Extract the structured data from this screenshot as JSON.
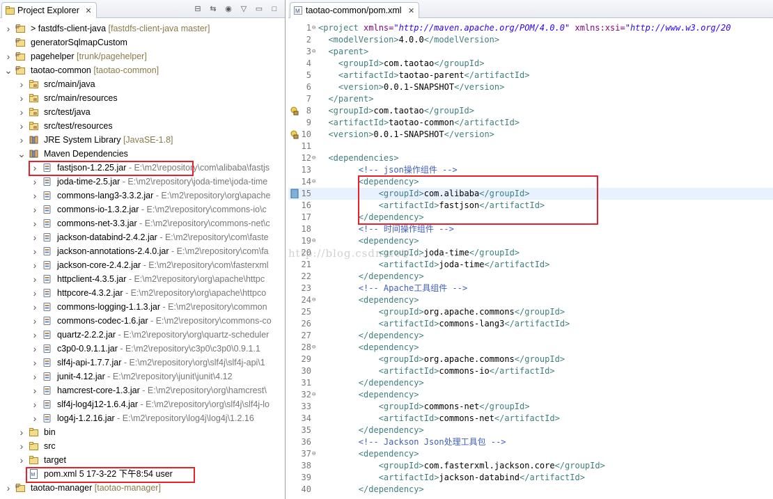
{
  "explorer": {
    "title": "Project Explorer",
    "close_glyph": "✕",
    "rows": [
      {
        "indent": 0,
        "arrow": ">",
        "icon": "project",
        "label": "> fastdfs-client-java",
        "deco": "[fastdfs-client-java master]",
        "path": ""
      },
      {
        "indent": 0,
        "arrow": "",
        "icon": "project",
        "label": "generatorSqlmapCustom",
        "deco": "",
        "path": ""
      },
      {
        "indent": 0,
        "arrow": ">",
        "icon": "project",
        "label": "pagehelper",
        "deco": "[trunk/pagehelper]",
        "path": ""
      },
      {
        "indent": 0,
        "arrow": "v",
        "icon": "project",
        "label": "taotao-common",
        "deco": "[taotao-common]",
        "path": ""
      },
      {
        "indent": 1,
        "arrow": ">",
        "icon": "srcfolder",
        "label": "src/main/java",
        "deco": "",
        "path": ""
      },
      {
        "indent": 1,
        "arrow": ">",
        "icon": "srcfolder",
        "label": "src/main/resources",
        "deco": "",
        "path": ""
      },
      {
        "indent": 1,
        "arrow": ">",
        "icon": "srcfolder",
        "label": "src/test/java",
        "deco": "",
        "path": ""
      },
      {
        "indent": 1,
        "arrow": ">",
        "icon": "srcfolder",
        "label": "src/test/resources",
        "deco": "",
        "path": ""
      },
      {
        "indent": 1,
        "arrow": ">",
        "icon": "library",
        "label": "JRE System Library",
        "deco": "[JavaSE-1.8]",
        "path": ""
      },
      {
        "indent": 1,
        "arrow": "v",
        "icon": "library",
        "label": "Maven Dependencies",
        "deco": "",
        "path": ""
      },
      {
        "indent": 2,
        "arrow": ">",
        "icon": "jar",
        "label": "fastjson-1.2.25.jar",
        "deco": "",
        "path": " - E:\\m2\\repository\\com\\alibaba\\fastjs"
      },
      {
        "indent": 2,
        "arrow": ">",
        "icon": "jar",
        "label": "joda-time-2.5.jar",
        "deco": "",
        "path": " - E:\\m2\\repository\\joda-time\\joda-time"
      },
      {
        "indent": 2,
        "arrow": ">",
        "icon": "jar",
        "label": "commons-lang3-3.3.2.jar",
        "deco": "",
        "path": " - E:\\m2\\repository\\org\\apache"
      },
      {
        "indent": 2,
        "arrow": ">",
        "icon": "jar",
        "label": "commons-io-1.3.2.jar",
        "deco": "",
        "path": " - E:\\m2\\repository\\commons-io\\c"
      },
      {
        "indent": 2,
        "arrow": ">",
        "icon": "jar",
        "label": "commons-net-3.3.jar",
        "deco": "",
        "path": " - E:\\m2\\repository\\commons-net\\c"
      },
      {
        "indent": 2,
        "arrow": ">",
        "icon": "jar",
        "label": "jackson-databind-2.4.2.jar",
        "deco": "",
        "path": " - E:\\m2\\repository\\com\\faste"
      },
      {
        "indent": 2,
        "arrow": ">",
        "icon": "jar",
        "label": "jackson-annotations-2.4.0.jar",
        "deco": "",
        "path": " - E:\\m2\\repository\\com\\fa"
      },
      {
        "indent": 2,
        "arrow": ">",
        "icon": "jar",
        "label": "jackson-core-2.4.2.jar",
        "deco": "",
        "path": " - E:\\m2\\repository\\com\\fasterxml"
      },
      {
        "indent": 2,
        "arrow": ">",
        "icon": "jar",
        "label": "httpclient-4.3.5.jar",
        "deco": "",
        "path": " - E:\\m2\\repository\\org\\apache\\httpc"
      },
      {
        "indent": 2,
        "arrow": ">",
        "icon": "jar",
        "label": "httpcore-4.3.2.jar",
        "deco": "",
        "path": " - E:\\m2\\repository\\org\\apache\\httpco"
      },
      {
        "indent": 2,
        "arrow": ">",
        "icon": "jar",
        "label": "commons-logging-1.1.3.jar",
        "deco": "",
        "path": " - E:\\m2\\repository\\common"
      },
      {
        "indent": 2,
        "arrow": ">",
        "icon": "jar",
        "label": "commons-codec-1.6.jar",
        "deco": "",
        "path": " - E:\\m2\\repository\\commons-co"
      },
      {
        "indent": 2,
        "arrow": ">",
        "icon": "jar",
        "label": "quartz-2.2.2.jar",
        "deco": "",
        "path": " - E:\\m2\\repository\\org\\quartz-scheduler"
      },
      {
        "indent": 2,
        "arrow": ">",
        "icon": "jar",
        "label": "c3p0-0.9.1.1.jar",
        "deco": "",
        "path": " - E:\\m2\\repository\\c3p0\\c3p0\\0.9.1.1"
      },
      {
        "indent": 2,
        "arrow": ">",
        "icon": "jar",
        "label": "slf4j-api-1.7.7.jar",
        "deco": "",
        "path": " - E:\\m2\\repository\\org\\slf4j\\slf4j-api\\1"
      },
      {
        "indent": 2,
        "arrow": ">",
        "icon": "jar",
        "label": "junit-4.12.jar",
        "deco": "",
        "path": " - E:\\m2\\repository\\junit\\junit\\4.12"
      },
      {
        "indent": 2,
        "arrow": ">",
        "icon": "jar",
        "label": "hamcrest-core-1.3.jar",
        "deco": "",
        "path": " - E:\\m2\\repository\\org\\hamcrest\\"
      },
      {
        "indent": 2,
        "arrow": ">",
        "icon": "jar",
        "label": "slf4j-log4j12-1.6.4.jar",
        "deco": "",
        "path": " - E:\\m2\\repository\\org\\slf4j\\slf4j-lo"
      },
      {
        "indent": 2,
        "arrow": ">",
        "icon": "jar",
        "label": "log4j-1.2.16.jar",
        "deco": "",
        "path": " - E:\\m2\\repository\\log4j\\log4j\\1.2.16"
      },
      {
        "indent": 1,
        "arrow": ">",
        "icon": "folder",
        "label": "bin",
        "deco": "",
        "path": ""
      },
      {
        "indent": 1,
        "arrow": ">",
        "icon": "folder",
        "label": "src",
        "deco": "",
        "path": ""
      },
      {
        "indent": 1,
        "arrow": ">",
        "icon": "folder",
        "label": "target",
        "deco": "",
        "path": ""
      },
      {
        "indent": 1,
        "arrow": "",
        "icon": "xmlfile",
        "label": "pom.xml 5  17-3-22 下午8:54  user",
        "deco": "",
        "path": ""
      },
      {
        "indent": 0,
        "arrow": ">",
        "icon": "project",
        "label": "taotao-manager",
        "deco": "[taotao-manager]",
        "path": ""
      }
    ]
  },
  "editor": {
    "tab_title": "taotao-common/pom.xml",
    "close_glyph": "✕",
    "watermark": "http://blog.csdn.net/..............",
    "lines": [
      {
        "n": "1",
        "fold": "⊖",
        "mark": "",
        "code": "<project xmlns=\"http://maven.apache.org/POM/4.0.0\" xmlns:xsi=\"http://www.w3.org/20"
      },
      {
        "n": "2",
        "fold": "",
        "mark": "",
        "code": "  <modelVersion>4.0.0</modelVersion>"
      },
      {
        "n": "3",
        "fold": "⊖",
        "mark": "",
        "code": "  <parent>"
      },
      {
        "n": "4",
        "fold": "",
        "mark": "",
        "code": "    <groupId>com.taotao</groupId>"
      },
      {
        "n": "5",
        "fold": "",
        "mark": "",
        "code": "    <artifactId>taotao-parent</artifactId>"
      },
      {
        "n": "6",
        "fold": "",
        "mark": "",
        "code": "    <version>0.0.1-SNAPSHOT</version>"
      },
      {
        "n": "7",
        "fold": "",
        "mark": "",
        "code": "  </parent>"
      },
      {
        "n": "8",
        "fold": "",
        "mark": "warn",
        "code": "  <groupId>com.taotao</groupId>"
      },
      {
        "n": "9",
        "fold": "",
        "mark": "",
        "code": "  <artifactId>taotao-common</artifactId>"
      },
      {
        "n": "10",
        "fold": "",
        "mark": "warn",
        "code": "  <version>0.0.1-SNAPSHOT</version>"
      },
      {
        "n": "11",
        "fold": "",
        "mark": "",
        "code": ""
      },
      {
        "n": "12",
        "fold": "⊖",
        "mark": "",
        "code": "  <dependencies>"
      },
      {
        "n": "13",
        "fold": "",
        "mark": "",
        "code": "        <!-- json操作组件 -->"
      },
      {
        "n": "14",
        "fold": "⊖",
        "mark": "",
        "code": "        <dependency>"
      },
      {
        "n": "15",
        "fold": "",
        "mark": "cur",
        "code": "            <groupId>com.alibaba</groupId>"
      },
      {
        "n": "16",
        "fold": "",
        "mark": "",
        "code": "            <artifactId>fastjson</artifactId>"
      },
      {
        "n": "17",
        "fold": "",
        "mark": "",
        "code": "        </dependency>"
      },
      {
        "n": "18",
        "fold": "",
        "mark": "",
        "code": "        <!-- 时间操作组件 -->"
      },
      {
        "n": "19",
        "fold": "⊖",
        "mark": "",
        "code": "        <dependency>"
      },
      {
        "n": "20",
        "fold": "",
        "mark": "",
        "code": "            <groupId>joda-time</groupId>"
      },
      {
        "n": "21",
        "fold": "",
        "mark": "",
        "code": "            <artifactId>joda-time</artifactId>"
      },
      {
        "n": "22",
        "fold": "",
        "mark": "",
        "code": "        </dependency>"
      },
      {
        "n": "23",
        "fold": "",
        "mark": "",
        "code": "        <!-- Apache工具组件 -->"
      },
      {
        "n": "24",
        "fold": "⊖",
        "mark": "",
        "code": "        <dependency>"
      },
      {
        "n": "25",
        "fold": "",
        "mark": "",
        "code": "            <groupId>org.apache.commons</groupId>"
      },
      {
        "n": "26",
        "fold": "",
        "mark": "",
        "code": "            <artifactId>commons-lang3</artifactId>"
      },
      {
        "n": "27",
        "fold": "",
        "mark": "",
        "code": "        </dependency>"
      },
      {
        "n": "28",
        "fold": "⊖",
        "mark": "",
        "code": "        <dependency>"
      },
      {
        "n": "29",
        "fold": "",
        "mark": "",
        "code": "            <groupId>org.apache.commons</groupId>"
      },
      {
        "n": "30",
        "fold": "",
        "mark": "",
        "code": "            <artifactId>commons-io</artifactId>"
      },
      {
        "n": "31",
        "fold": "",
        "mark": "",
        "code": "        </dependency>"
      },
      {
        "n": "32",
        "fold": "⊖",
        "mark": "",
        "code": "        <dependency>"
      },
      {
        "n": "33",
        "fold": "",
        "mark": "",
        "code": "            <groupId>commons-net</groupId>"
      },
      {
        "n": "34",
        "fold": "",
        "mark": "",
        "code": "            <artifactId>commons-net</artifactId>"
      },
      {
        "n": "35",
        "fold": "",
        "mark": "",
        "code": "        </dependency>"
      },
      {
        "n": "36",
        "fold": "",
        "mark": "",
        "code": "        <!-- Jackson Json处理工具包 -->"
      },
      {
        "n": "37",
        "fold": "⊖",
        "mark": "",
        "code": "        <dependency>"
      },
      {
        "n": "38",
        "fold": "",
        "mark": "",
        "code": "            <groupId>com.fasterxml.jackson.core</groupId>"
      },
      {
        "n": "39",
        "fold": "",
        "mark": "",
        "code": "            <artifactId>jackson-databind</artifactId>"
      },
      {
        "n": "40",
        "fold": "",
        "mark": "",
        "code": "        </dependency>"
      }
    ]
  }
}
